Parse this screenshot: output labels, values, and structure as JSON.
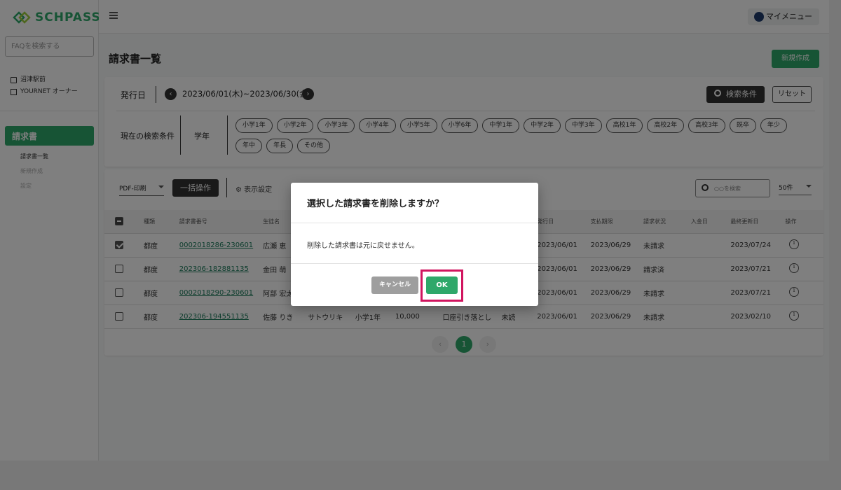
{
  "brand": {
    "name": "SCHPASS"
  },
  "sidebar": {
    "faq_placeholder": "FAQを検索する",
    "school": "沼津駅前",
    "owner": "YOURNET オーナー",
    "menu_head": "請求書",
    "items": [
      {
        "label": "請求書一覧",
        "active": true
      },
      {
        "label": "新規作成",
        "active": false
      },
      {
        "label": "設定",
        "active": false
      }
    ]
  },
  "topbar": {
    "my_menu": "マイメニュー"
  },
  "page": {
    "title": "請求書一覧",
    "new_button": "新規作成"
  },
  "filter": {
    "issued_label": "発行日",
    "date_range": "2023/06/01(木)~2023/06/30(金)",
    "search_cond_button": "検索条件",
    "reset_button": "リセット",
    "current_conditions_label": "現在の検索条件",
    "grade_label": "学年",
    "chips": [
      "小学1年",
      "小学2年",
      "小学3年",
      "小学4年",
      "小学5年",
      "小学6年",
      "中学1年",
      "中学2年",
      "中学3年",
      "高校1年",
      "高校2年",
      "高校3年",
      "既卒",
      "年少",
      "年中",
      "年長",
      "その他"
    ]
  },
  "list": {
    "pdf_select": "PDF-印刷",
    "bulk_button": "一括操作",
    "display_settings": "表示設定",
    "search_placeholder": "○○を検索",
    "per_page": "50件",
    "columns": [
      "種類",
      "請求書番号",
      "生徒名",
      "",
      "",
      "",
      "",
      "",
      "発行日",
      "支払期限",
      "請求状況",
      "入金日",
      "最終更新日",
      "操作"
    ],
    "rows": [
      {
        "checked": true,
        "type": "都度",
        "invoice_no": "0002018286-230601",
        "student": "広瀬 恵",
        "kana": "",
        "grade": "",
        "amount": "",
        "method": "",
        "status2": "",
        "issued": "2023/06/01",
        "due": "2023/06/29",
        "billing": "未請求",
        "paid": "",
        "updated": "2023/07/24"
      },
      {
        "checked": false,
        "type": "都度",
        "invoice_no": "202306-182881135",
        "student": "金田 萌",
        "kana": "",
        "grade": "",
        "amount": "",
        "method": "",
        "status2": "",
        "issued": "2023/06/01",
        "due": "2023/06/29",
        "billing": "請求済",
        "paid": "",
        "updated": "2023/07/21"
      },
      {
        "checked": false,
        "type": "都度",
        "invoice_no": "0002018290-230601",
        "student": "阿部 宏太",
        "kana": "",
        "grade": "",
        "amount": "",
        "method": "",
        "status2": "",
        "issued": "2023/06/01",
        "due": "2023/06/29",
        "billing": "未請求",
        "paid": "",
        "updated": "2023/07/21"
      },
      {
        "checked": false,
        "type": "都度",
        "invoice_no": "202306-194551135",
        "student": "佐藤 りき",
        "kana": "サトウリキ",
        "grade": "小学1年",
        "amount": "10,000",
        "method": "口座引き落とし",
        "status2": "未読",
        "issued": "2023/06/01",
        "due": "2023/06/29",
        "billing": "未請求",
        "paid": "",
        "updated": "2023/02/10"
      }
    ],
    "current_page": "1"
  },
  "dialog": {
    "title": "選択した請求書を削除しますか？",
    "message": "削除した請求書は元に戻せません。",
    "cancel": "キャンセル",
    "ok": "OK"
  },
  "colors": {
    "brand_green": "#2ea86a",
    "highlight": "#d1155f"
  }
}
